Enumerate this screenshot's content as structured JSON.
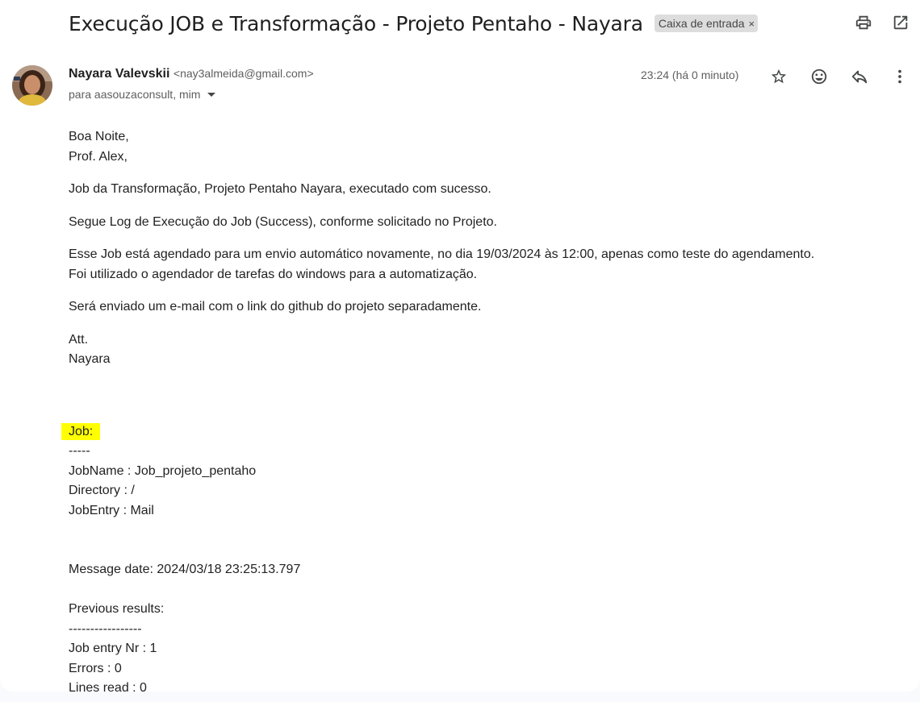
{
  "subject": "Execução JOB e Transformação - Projeto Pentaho - Nayara",
  "label": "Caixa de entrada",
  "label_close": "×",
  "sender": {
    "name": "Nayara Valevskii",
    "email": "<nay3almeida@gmail.com>",
    "recipients": "para aasouzaconsult, mim"
  },
  "time": "23:24 (há 0 minuto)",
  "icons": {
    "print": "print-icon",
    "open_new": "open-in-new-window-icon",
    "star": "star-icon",
    "emoji": "emoji-reaction-icon",
    "reply": "reply-icon",
    "more": "more-vertical-icon"
  },
  "colors": {
    "highlight": "#ffff00",
    "chip": "#dddddd"
  },
  "body": {
    "greeting": [
      "Boa Noite,",
      "Prof. Alex,"
    ],
    "p1": "Job da Transformação, Projeto Pentaho Nayara, executado com sucesso.",
    "p2": "Segue Log de Execução do Job (Success), conforme solicitado no Projeto.",
    "p3": [
      "Esse Job está agendado para um envio automático novamente, no dia 19/03/2024 às 12:00, apenas como teste do agendamento.",
      "Foi utilizado o agendador de tarefas do windows para a automatização."
    ],
    "p4": "Será enviado um e-mail com o link do github do projeto separadamente.",
    "signoff": [
      "Att.",
      "Nayara"
    ],
    "job_label": "Job:",
    "job_sep": "-----",
    "job_lines": [
      "JobName : Job_projeto_pentaho",
      "Directory : /",
      "JobEntry : Mail"
    ],
    "message_date": "Message date: 2024/03/18 23:25:13.797",
    "prev_label": "Previous results:",
    "prev_sep": "-----------------",
    "prev_lines": [
      "Job entry Nr : 1",
      "Errors : 0",
      "Lines read : 0"
    ]
  }
}
